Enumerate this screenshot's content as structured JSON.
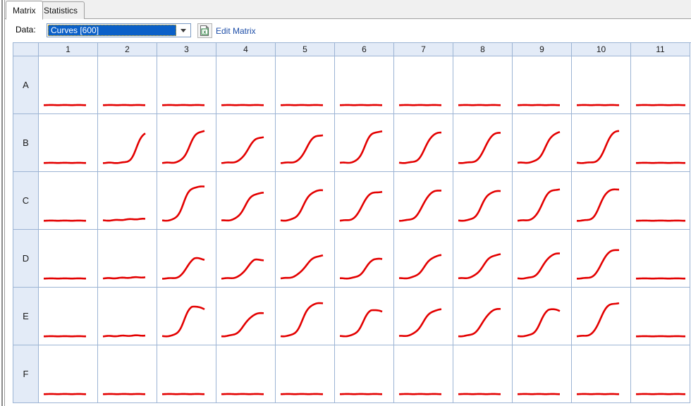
{
  "window": {
    "tabs": [
      {
        "id": "matrix",
        "label": "Matrix",
        "active": true
      },
      {
        "id": "statistics",
        "label": "Statistics",
        "active": false
      }
    ]
  },
  "toolbar": {
    "data_label": "Data:",
    "data_combo_value": "Curves [600]",
    "data_combo_options": [
      "Curves [600]"
    ],
    "dropdown_icon": "chevron-down-icon",
    "edit_matrix_icon": "spreadsheet-icon",
    "edit_matrix_label": "Edit Matrix",
    "link_color": "#1f4fa8"
  },
  "matrix": {
    "corner_label": "",
    "column_headers": [
      "1",
      "2",
      "3",
      "4",
      "5",
      "6",
      "7",
      "8",
      "9",
      "10",
      "11"
    ],
    "row_headers": [
      "A",
      "B",
      "C",
      "D",
      "E",
      "F"
    ],
    "curve_color": "#e30000",
    "grid_line_color": "#9cb4d4",
    "header_fill": "#e3ebf7",
    "well_fill": "#ffffff",
    "curves": [
      {
        "row": "A",
        "wells": [
          {
            "col": "1",
            "type": "flat",
            "baseline": 0.08,
            "plateau": 0.08,
            "midpoint": 0.5,
            "steepness": 0.0
          },
          {
            "col": "2",
            "type": "flat",
            "baseline": 0.08,
            "plateau": 0.08,
            "midpoint": 0.5,
            "steepness": 0.0
          },
          {
            "col": "3",
            "type": "flat",
            "baseline": 0.08,
            "plateau": 0.08,
            "midpoint": 0.5,
            "steepness": 0.0
          },
          {
            "col": "4",
            "type": "flat",
            "baseline": 0.08,
            "plateau": 0.08,
            "midpoint": 0.5,
            "steepness": 0.0
          },
          {
            "col": "5",
            "type": "flat",
            "baseline": 0.08,
            "plateau": 0.08,
            "midpoint": 0.5,
            "steepness": 0.0
          },
          {
            "col": "6",
            "type": "flat",
            "baseline": 0.08,
            "plateau": 0.08,
            "midpoint": 0.5,
            "steepness": 0.0
          },
          {
            "col": "7",
            "type": "flat",
            "baseline": 0.08,
            "plateau": 0.08,
            "midpoint": 0.5,
            "steepness": 0.0
          },
          {
            "col": "8",
            "type": "flat",
            "baseline": 0.08,
            "plateau": 0.08,
            "midpoint": 0.5,
            "steepness": 0.0
          },
          {
            "col": "9",
            "type": "flat",
            "baseline": 0.08,
            "plateau": 0.08,
            "midpoint": 0.5,
            "steepness": 0.0
          },
          {
            "col": "10",
            "type": "flat",
            "baseline": 0.08,
            "plateau": 0.08,
            "midpoint": 0.5,
            "steepness": 0.0
          },
          {
            "col": "11",
            "type": "flat-wide",
            "baseline": 0.08,
            "plateau": 0.08,
            "midpoint": 0.5,
            "steepness": 0.0
          }
        ]
      },
      {
        "row": "B",
        "wells": [
          {
            "col": "1",
            "type": "flat",
            "baseline": 0.08,
            "plateau": 0.08,
            "midpoint": 0.5,
            "steepness": 0.0
          },
          {
            "col": "2",
            "type": "sigmoid",
            "baseline": 0.08,
            "plateau": 0.8,
            "midpoint": 0.8,
            "steepness": 14
          },
          {
            "col": "3",
            "type": "sigmoid",
            "baseline": 0.08,
            "plateau": 0.82,
            "midpoint": 0.64,
            "steepness": 12
          },
          {
            "col": "4",
            "type": "sigmoid",
            "baseline": 0.08,
            "plateau": 0.68,
            "midpoint": 0.62,
            "steepness": 11
          },
          {
            "col": "5",
            "type": "sigmoid",
            "baseline": 0.08,
            "plateau": 0.72,
            "midpoint": 0.6,
            "steepness": 12
          },
          {
            "col": "6",
            "type": "sigmoid",
            "baseline": 0.08,
            "plateau": 0.8,
            "midpoint": 0.58,
            "steepness": 13
          },
          {
            "col": "7",
            "type": "sigmoid",
            "baseline": 0.08,
            "plateau": 0.78,
            "midpoint": 0.62,
            "steepness": 12
          },
          {
            "col": "8",
            "type": "sigmoid",
            "baseline": 0.08,
            "plateau": 0.78,
            "midpoint": 0.63,
            "steepness": 12
          },
          {
            "col": "9",
            "type": "sigmoid",
            "baseline": 0.08,
            "plateau": 0.8,
            "midpoint": 0.66,
            "steepness": 11
          },
          {
            "col": "10",
            "type": "sigmoid",
            "baseline": 0.08,
            "plateau": 0.82,
            "midpoint": 0.68,
            "steepness": 13
          },
          {
            "col": "11",
            "type": "flat-wide",
            "baseline": 0.08,
            "plateau": 0.08,
            "midpoint": 0.5,
            "steepness": 0.0
          }
        ]
      },
      {
        "row": "C",
        "wells": [
          {
            "col": "1",
            "type": "flat",
            "baseline": 0.08,
            "plateau": 0.08,
            "midpoint": 0.5,
            "steepness": 0.0
          },
          {
            "col": "2",
            "type": "near-flat",
            "baseline": 0.08,
            "plateau": 0.12,
            "midpoint": 0.45,
            "steepness": 6
          },
          {
            "col": "3",
            "type": "sigmoid",
            "baseline": 0.08,
            "plateau": 0.86,
            "midpoint": 0.5,
            "steepness": 13
          },
          {
            "col": "4",
            "type": "sigmoid",
            "baseline": 0.08,
            "plateau": 0.72,
            "midpoint": 0.55,
            "steepness": 11
          },
          {
            "col": "5",
            "type": "sigmoid",
            "baseline": 0.08,
            "plateau": 0.78,
            "midpoint": 0.54,
            "steepness": 11
          },
          {
            "col": "6",
            "type": "sigmoid",
            "baseline": 0.08,
            "plateau": 0.74,
            "midpoint": 0.52,
            "steepness": 12
          },
          {
            "col": "7",
            "type": "sigmoid",
            "baseline": 0.08,
            "plateau": 0.78,
            "midpoint": 0.56,
            "steepness": 11
          },
          {
            "col": "8",
            "type": "sigmoid",
            "baseline": 0.08,
            "plateau": 0.76,
            "midpoint": 0.55,
            "steepness": 12
          },
          {
            "col": "9",
            "type": "sigmoid",
            "baseline": 0.08,
            "plateau": 0.8,
            "midpoint": 0.57,
            "steepness": 12
          },
          {
            "col": "10",
            "type": "sigmoid",
            "baseline": 0.08,
            "plateau": 0.8,
            "midpoint": 0.55,
            "steepness": 13
          },
          {
            "col": "11",
            "type": "flat-wide",
            "baseline": 0.08,
            "plateau": 0.08,
            "midpoint": 0.5,
            "steepness": 0.0
          }
        ]
      },
      {
        "row": "D",
        "wells": [
          {
            "col": "1",
            "type": "flat",
            "baseline": 0.08,
            "plateau": 0.08,
            "midpoint": 0.5,
            "steepness": 0.0
          },
          {
            "col": "2",
            "type": "near-flat",
            "baseline": 0.08,
            "plateau": 0.11,
            "midpoint": 0.5,
            "steepness": 5
          },
          {
            "col": "3",
            "type": "sigmoid-peak",
            "baseline": 0.08,
            "plateau": 0.58,
            "midpoint": 0.58,
            "steepness": 13
          },
          {
            "col": "4",
            "type": "sigmoid-peak",
            "baseline": 0.08,
            "plateau": 0.56,
            "midpoint": 0.6,
            "steepness": 11
          },
          {
            "col": "5",
            "type": "sigmoid",
            "baseline": 0.08,
            "plateau": 0.62,
            "midpoint": 0.58,
            "steepness": 9
          },
          {
            "col": "6",
            "type": "sigmoid-peak",
            "baseline": 0.08,
            "plateau": 0.58,
            "midpoint": 0.62,
            "steepness": 11
          },
          {
            "col": "7",
            "type": "sigmoid",
            "baseline": 0.08,
            "plateau": 0.62,
            "midpoint": 0.6,
            "steepness": 10
          },
          {
            "col": "8",
            "type": "sigmoid",
            "baseline": 0.08,
            "plateau": 0.64,
            "midpoint": 0.58,
            "steepness": 10
          },
          {
            "col": "9",
            "type": "sigmoid",
            "baseline": 0.08,
            "plateau": 0.66,
            "midpoint": 0.6,
            "steepness": 11
          },
          {
            "col": "10",
            "type": "sigmoid",
            "baseline": 0.08,
            "plateau": 0.74,
            "midpoint": 0.58,
            "steepness": 12
          },
          {
            "col": "11",
            "type": "flat-wide",
            "baseline": 0.08,
            "plateau": 0.08,
            "midpoint": 0.5,
            "steepness": 0.0
          }
        ]
      },
      {
        "row": "E",
        "wells": [
          {
            "col": "1",
            "type": "flat",
            "baseline": 0.08,
            "plateau": 0.08,
            "midpoint": 0.5,
            "steepness": 0.0
          },
          {
            "col": "2",
            "type": "near-flat",
            "baseline": 0.08,
            "plateau": 0.1,
            "midpoint": 0.5,
            "steepness": 5
          },
          {
            "col": "3",
            "type": "sigmoid-peak",
            "baseline": 0.08,
            "plateau": 0.82,
            "midpoint": 0.52,
            "steepness": 13
          },
          {
            "col": "4",
            "type": "sigmoid",
            "baseline": 0.08,
            "plateau": 0.62,
            "midpoint": 0.55,
            "steepness": 10
          },
          {
            "col": "5",
            "type": "sigmoid",
            "baseline": 0.08,
            "plateau": 0.84,
            "midpoint": 0.52,
            "steepness": 12
          },
          {
            "col": "6",
            "type": "sigmoid-peak",
            "baseline": 0.08,
            "plateau": 0.74,
            "midpoint": 0.55,
            "steepness": 12
          },
          {
            "col": "7",
            "type": "sigmoid",
            "baseline": 0.08,
            "plateau": 0.7,
            "midpoint": 0.56,
            "steepness": 10
          },
          {
            "col": "8",
            "type": "sigmoid",
            "baseline": 0.08,
            "plateau": 0.72,
            "midpoint": 0.58,
            "steepness": 10
          },
          {
            "col": "9",
            "type": "sigmoid-peak",
            "baseline": 0.08,
            "plateau": 0.76,
            "midpoint": 0.55,
            "steepness": 12
          },
          {
            "col": "10",
            "type": "sigmoid",
            "baseline": 0.08,
            "plateau": 0.84,
            "midpoint": 0.55,
            "steepness": 12
          },
          {
            "col": "11",
            "type": "flat-wide",
            "baseline": 0.08,
            "plateau": 0.08,
            "midpoint": 0.5,
            "steepness": 0.0
          }
        ]
      },
      {
        "row": "F",
        "wells": [
          {
            "col": "1",
            "type": "flat",
            "baseline": 0.08,
            "plateau": 0.08,
            "midpoint": 0.5,
            "steepness": 0.0
          },
          {
            "col": "2",
            "type": "flat",
            "baseline": 0.08,
            "plateau": 0.08,
            "midpoint": 0.5,
            "steepness": 0.0
          },
          {
            "col": "3",
            "type": "flat",
            "baseline": 0.08,
            "plateau": 0.08,
            "midpoint": 0.5,
            "steepness": 0.0
          },
          {
            "col": "4",
            "type": "flat",
            "baseline": 0.08,
            "plateau": 0.08,
            "midpoint": 0.5,
            "steepness": 0.0
          },
          {
            "col": "5",
            "type": "flat",
            "baseline": 0.08,
            "plateau": 0.08,
            "midpoint": 0.5,
            "steepness": 0.0
          },
          {
            "col": "6",
            "type": "flat",
            "baseline": 0.08,
            "plateau": 0.08,
            "midpoint": 0.5,
            "steepness": 0.0
          },
          {
            "col": "7",
            "type": "flat",
            "baseline": 0.08,
            "plateau": 0.08,
            "midpoint": 0.5,
            "steepness": 0.0
          },
          {
            "col": "8",
            "type": "flat",
            "baseline": 0.08,
            "plateau": 0.08,
            "midpoint": 0.5,
            "steepness": 0.0
          },
          {
            "col": "9",
            "type": "flat",
            "baseline": 0.08,
            "plateau": 0.08,
            "midpoint": 0.5,
            "steepness": 0.0
          },
          {
            "col": "10",
            "type": "flat",
            "baseline": 0.08,
            "plateau": 0.08,
            "midpoint": 0.5,
            "steepness": 0.0
          },
          {
            "col": "11",
            "type": "flat-wide",
            "baseline": 0.08,
            "plateau": 0.08,
            "midpoint": 0.5,
            "steepness": 0.0
          }
        ]
      }
    ]
  }
}
